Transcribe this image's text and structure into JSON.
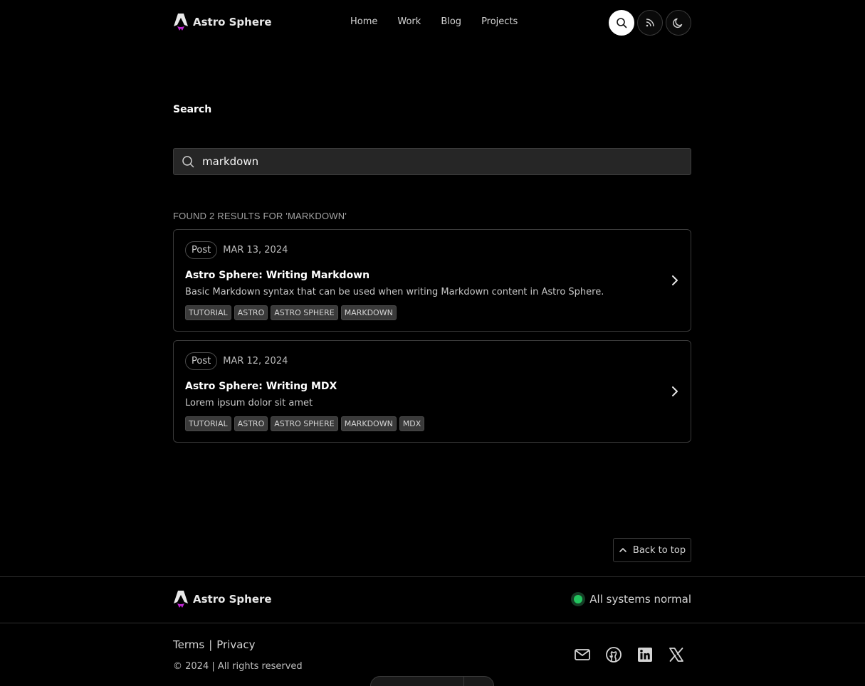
{
  "header": {
    "brand": "Astro Sphere",
    "nav": [
      "Home",
      "Work",
      "Blog",
      "Projects"
    ],
    "actions": [
      "search-icon",
      "rss-icon",
      "moon-icon"
    ]
  },
  "search": {
    "title": "Search",
    "query": "markdown",
    "results_label": "FOUND 2 RESULTS FOR 'MARKDOWN'"
  },
  "results": [
    {
      "type": "Post",
      "date": "MAR 13, 2024",
      "title": "Astro Sphere: Writing Markdown",
      "description": "Basic Markdown syntax that can be used when writing Markdown content in Astro Sphere.",
      "tags": [
        "TUTORIAL",
        "ASTRO",
        "ASTRO SPHERE",
        "MARKDOWN"
      ]
    },
    {
      "type": "Post",
      "date": "MAR 12, 2024",
      "title": "Astro Sphere: Writing MDX",
      "description": "Lorem ipsum dolor sit amet",
      "tags": [
        "TUTORIAL",
        "ASTRO",
        "ASTRO SPHERE",
        "MARKDOWN",
        "MDX"
      ]
    }
  ],
  "back_to_top": "Back to top",
  "footer": {
    "brand": "Astro Sphere",
    "status": "All systems normal",
    "terms": "Terms",
    "separator": "|",
    "privacy": "Privacy",
    "copyright": "© 2024 | All rights reserved",
    "socials": [
      "mail-icon",
      "github-icon",
      "linkedin-icon",
      "x-icon"
    ]
  },
  "colors": {
    "background": "#000000",
    "status_green": "#22c55e",
    "logo_accent": "#c026d3"
  }
}
